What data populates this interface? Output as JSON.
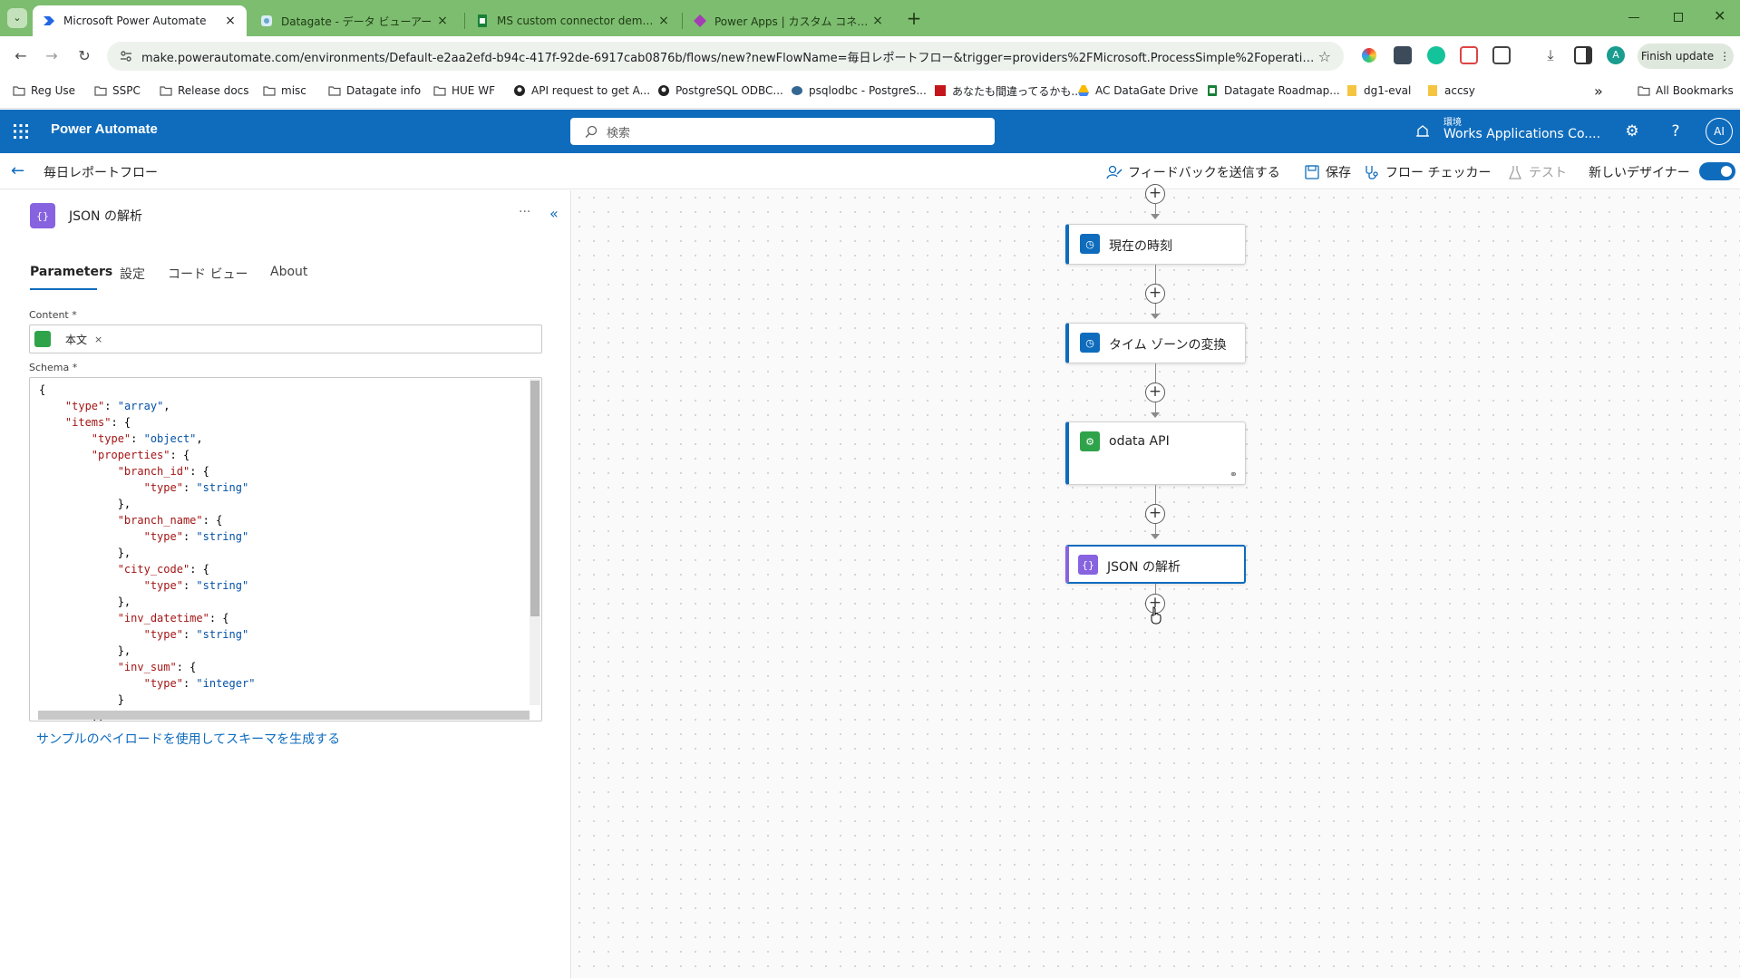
{
  "browser": {
    "tabs": [
      {
        "title": "Microsoft Power Automate",
        "active": true,
        "icon": "power-automate-icon"
      },
      {
        "title": "Datagate - データ ビューアー",
        "active": false,
        "icon": "datagate-icon"
      },
      {
        "title": "MS custom connector demo m",
        "active": false,
        "icon": "sheets-icon"
      },
      {
        "title": "Power Apps | カスタム コネクタ",
        "active": false,
        "icon": "power-apps-icon"
      }
    ],
    "close_glyph": "×",
    "new_tab_glyph": "+",
    "url": "make.powerautomate.com/environments/Default-e2aa2efd-b94c-417f-92de-6917cab0876b/flows/new?newFlowName=毎日レポートフロー&trigger=providers%2FMicrosoft.ProcessSimple%2FoperationGroups%...",
    "finish_update": "Finish update",
    "profile_initial": "A",
    "bookmarks": [
      {
        "label": "Reg Use",
        "icon": "folder-icon"
      },
      {
        "label": "SSPC",
        "icon": "folder-icon"
      },
      {
        "label": "Release docs",
        "icon": "folder-icon"
      },
      {
        "label": "misc",
        "icon": "folder-icon"
      },
      {
        "label": "Datagate info",
        "icon": "folder-icon"
      },
      {
        "label": "HUE WF",
        "icon": "folder-icon"
      },
      {
        "label": "API request to get A...",
        "icon": "github-icon"
      },
      {
        "label": "PostgreSQL ODBC...",
        "icon": "github-icon"
      },
      {
        "label": "psqlodbc - PostgreS...",
        "icon": "elephant-icon"
      },
      {
        "label": "あなたも間違ってるかも...",
        "icon": "news-icon"
      },
      {
        "label": "AC DataGate Drive",
        "icon": "drive-icon"
      },
      {
        "label": "Datagate Roadmap...",
        "icon": "sheets-icon"
      },
      {
        "label": "dg1-eval",
        "icon": "page-icon"
      },
      {
        "label": "accsy",
        "icon": "page-icon"
      }
    ],
    "all_bookmarks": "All Bookmarks",
    "overflow": "»"
  },
  "header": {
    "app_title": "Power Automate",
    "search_placeholder": "検索",
    "env_label": "環境",
    "env_name": "Works Applications Co....",
    "avatar": "AI"
  },
  "commandbar": {
    "flow_name": "毎日レポートフロー",
    "feedback": "フィードバックを送信する",
    "save": "保存",
    "flow_checker": "フロー チェッカー",
    "test": "テスト",
    "new_designer": "新しいデザイナー",
    "new_designer_on": true
  },
  "panel": {
    "title": "JSON の解析",
    "more": "···",
    "collapse": "«",
    "tabs": [
      "Parameters",
      "設定",
      "コード ビュー",
      "About"
    ],
    "content_label": "Content *",
    "content_token": "本文",
    "token_remove": "×",
    "schema_label": "Schema *",
    "schema_lines": [
      "{",
      "    \"type\": \"array\",",
      "    \"items\": {",
      "        \"type\": \"object\",",
      "        \"properties\": {",
      "            \"branch_id\": {",
      "                \"type\": \"string\"",
      "            },",
      "            \"branch_name\": {",
      "                \"type\": \"string\"",
      "            },",
      "            \"city_code\": {",
      "                \"type\": \"string\"",
      "            },",
      "            \"inv_datetime\": {",
      "                \"type\": \"string\"",
      "            },",
      "            \"inv_sum\": {",
      "                \"type\": \"integer\"",
      "            }",
      "        },"
    ],
    "sample_link": "サンプルのペイロードを使用してスキーマを生成する"
  },
  "canvas": {
    "plus_glyph": "+",
    "steps": [
      {
        "label": "現在の時刻",
        "icon": "clock-icon",
        "color": "#0f6cbd"
      },
      {
        "label": "タイム ゾーンの変換",
        "icon": "clock-icon",
        "color": "#0f6cbd"
      },
      {
        "label": "odata API",
        "icon": "connector-icon",
        "color": "#2fa34a"
      },
      {
        "label": "JSON の解析",
        "icon": "json-icon",
        "color": "#8763e0",
        "selected": true
      }
    ]
  },
  "colors": {
    "brand": "#0f6cbd",
    "tabstrip": "#7dbd6f",
    "json_accent": "#8763e0",
    "connector_green": "#2fa34a"
  }
}
